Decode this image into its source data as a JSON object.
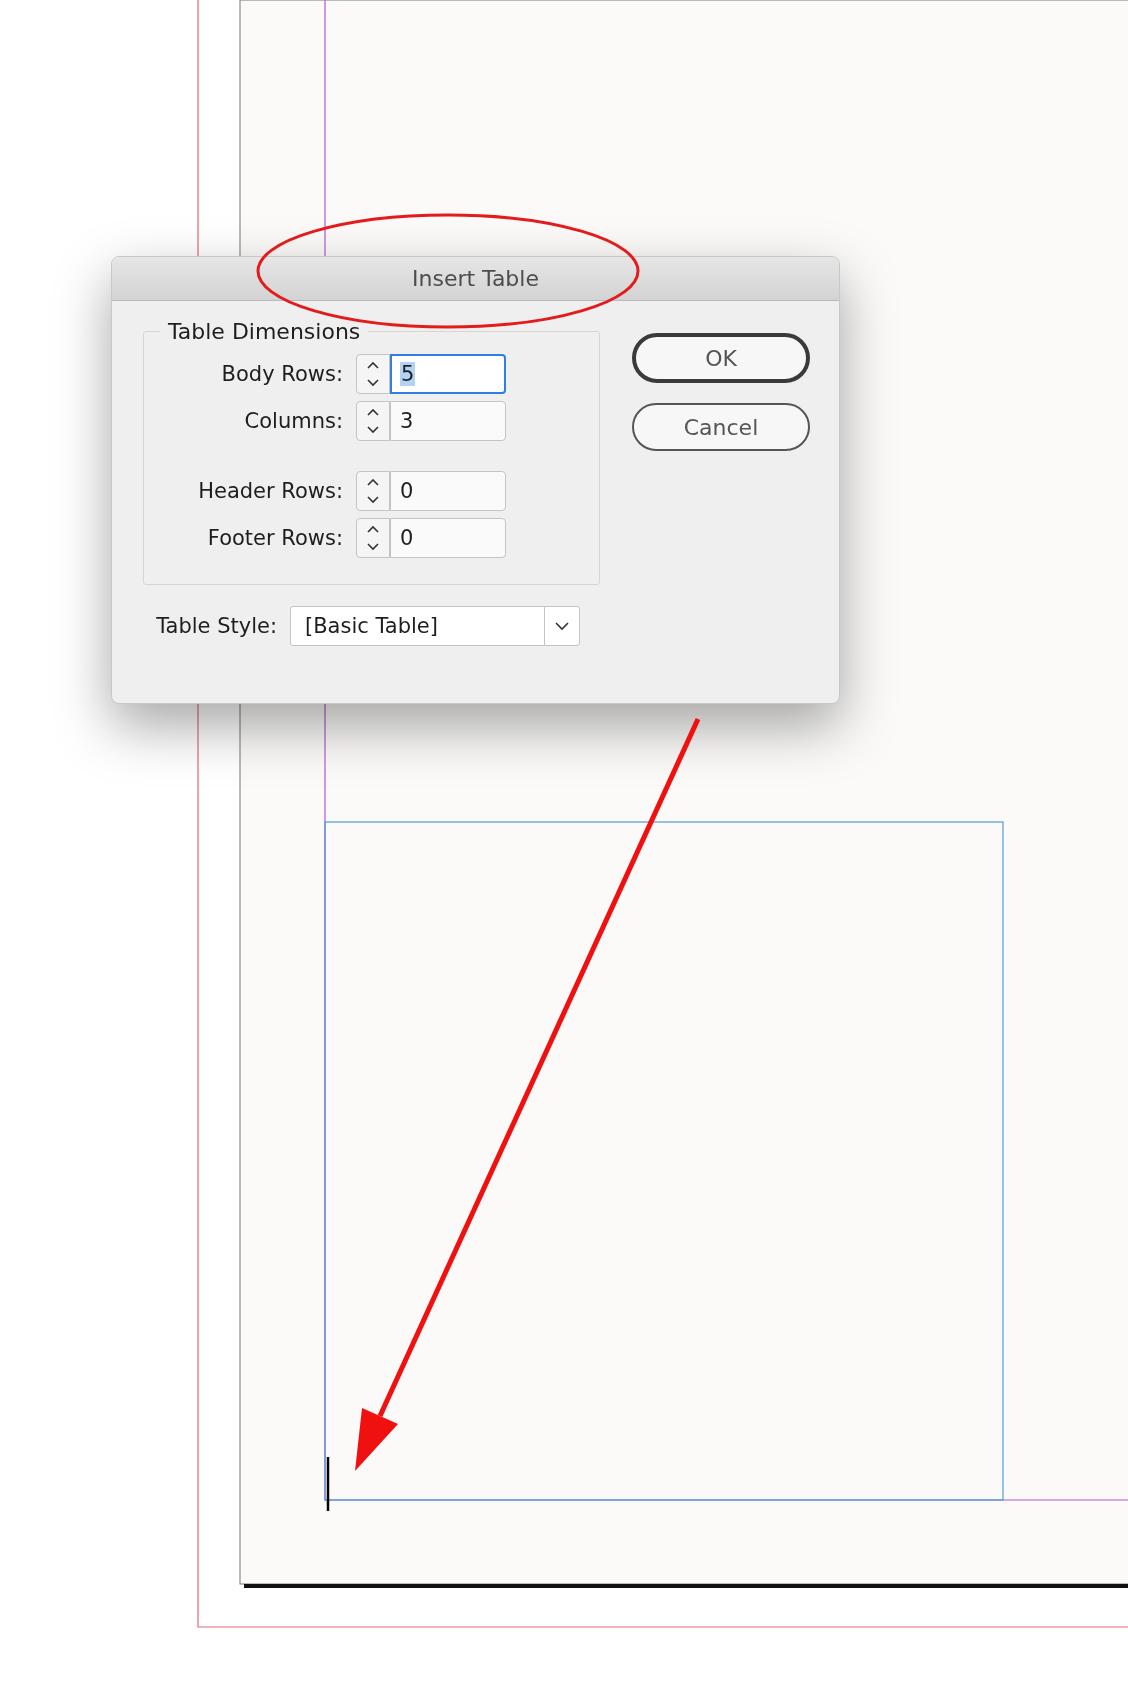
{
  "dialog": {
    "title": "Insert Table",
    "group": {
      "legend": "Table Dimensions",
      "size_fields": [
        {
          "label": "Body Rows:",
          "value": "5",
          "focused": true
        },
        {
          "label": "Columns:",
          "value": "3",
          "focused": false
        }
      ],
      "header_footer_fields": [
        {
          "label": "Header Rows:",
          "value": "0",
          "focused": false
        },
        {
          "label": "Footer Rows:",
          "value": "0",
          "focused": false
        }
      ]
    },
    "table_style": {
      "label": "Table Style:",
      "value": "[Basic Table]"
    },
    "buttons": [
      {
        "label": "OK",
        "default": true
      },
      {
        "label": "Cancel",
        "default": false
      }
    ]
  }
}
